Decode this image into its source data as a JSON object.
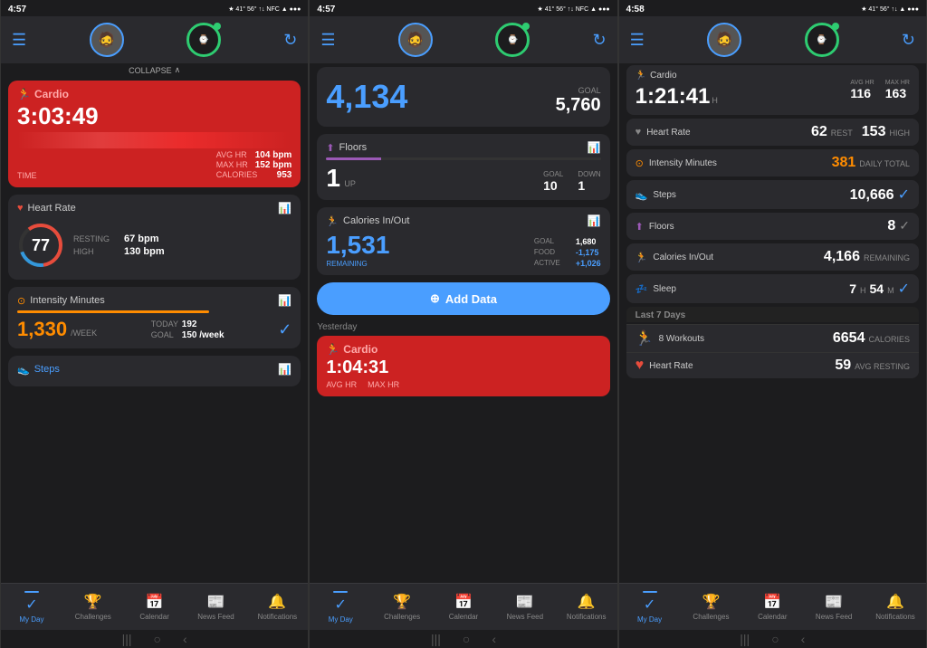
{
  "phone1": {
    "statusBar": {
      "time": "4:57",
      "icons": "★✦ 41° 56°C ⬤ ↑↓ ● NFC ▲ ⬤⬤⬤"
    },
    "header": {
      "menuIcon": "☰",
      "syncIcon": "↻"
    },
    "collapse": "COLLAPSE",
    "cardio": {
      "title": "Cardio",
      "icon": "🏃",
      "time": "3:03:49",
      "avgHrLabel": "AVG HR",
      "avgHr": "104 bpm",
      "maxHrLabel": "MAX HR",
      "maxHr": "152 bpm",
      "timeLabel": "TIME",
      "calories": "953",
      "caloriesLabel": "CALORIES"
    },
    "heartRate": {
      "title": "Heart Rate",
      "value": "77",
      "restingLabel": "RESTING",
      "restingValue": "67 bpm",
      "highLabel": "HIGH",
      "highValue": "130 bpm"
    },
    "intensityMinutes": {
      "title": "Intensity Minutes",
      "value": "1,330",
      "unit": "/WEEK",
      "todayLabel": "TODAY",
      "todayValue": "192",
      "goalLabel": "GOAL",
      "goalValue": "150 /week"
    },
    "steps": {
      "title": "Steps",
      "icon": "👟"
    }
  },
  "phone2": {
    "statusBar": {
      "time": "4:57"
    },
    "header": {
      "menuIcon": "☰",
      "syncIcon": "↻"
    },
    "stepsToday": {
      "value": "4,134",
      "goalLabel": "GOAL",
      "goalValue": "5,760"
    },
    "floors": {
      "title": "Floors",
      "icon": "⬆",
      "upValue": "1",
      "upLabel": "UP",
      "goalLabel": "GOAL",
      "goalValue": "10",
      "downLabel": "DOWN",
      "downValue": "1"
    },
    "calories": {
      "title": "Calories In/Out",
      "value": "1,531",
      "remainingLabel": "REMAINING",
      "goalLabel": "GOAL",
      "goalValue": "1,680",
      "foodLabel": "FOOD",
      "foodValue": "-1,175",
      "activeLabel": "ACTIVE",
      "activeValue": "+1,026"
    },
    "addData": "Add Data",
    "yesterday": "Yesterday",
    "yesterdayCardio": {
      "title": "Cardio",
      "avgHrLabel": "AVG HR",
      "maxHrLabel": "MAX HR"
    }
  },
  "phone3": {
    "statusBar": {
      "time": "4:58"
    },
    "header": {
      "menuIcon": "☰",
      "syncIcon": "↻"
    },
    "cardio": {
      "title": "Cardio",
      "time": "1:21:41",
      "timeUnit": "H",
      "avgHrLabel": "AVG HR",
      "avgHrValue": "116",
      "maxHrLabel": "MAX HR",
      "maxHrValue": "163"
    },
    "heartRate": {
      "title": "Heart Rate",
      "restValue": "62",
      "restLabel": "REST",
      "highValue": "153",
      "highLabel": "HIGH"
    },
    "intensityMinutes": {
      "title": "Intensity Minutes",
      "value": "381",
      "dailyLabel": "DAILY TOTAL"
    },
    "steps": {
      "title": "Steps",
      "value": "10,666"
    },
    "floors": {
      "title": "Floors",
      "value": "8"
    },
    "caloriesInOut": {
      "title": "Calories In/Out",
      "value": "4,166",
      "label": "REMAINING"
    },
    "sleep": {
      "title": "Sleep",
      "hours": "7",
      "hoursUnit": "H",
      "minutes": "54",
      "minutesUnit": "M"
    },
    "last7Days": {
      "header": "Last 7 Days",
      "workouts": {
        "icon": "🏃",
        "label": "8 Workouts",
        "value": "6654",
        "unit": "CALORIES"
      },
      "heartRate": {
        "icon": "❤",
        "label": "Heart Rate",
        "value": "59",
        "unit": "AVG RESTING"
      }
    }
  },
  "nav": {
    "myDay": "My Day",
    "challenges": "Challenges",
    "calendar": "Calendar",
    "newsFeed": "News Feed",
    "notifications": "Notifications"
  }
}
